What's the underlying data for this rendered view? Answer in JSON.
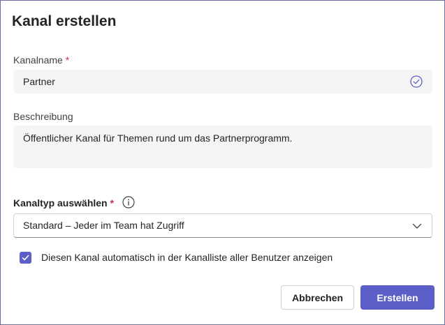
{
  "dialog": {
    "title": "Kanal erstellen"
  },
  "channel_name": {
    "label": "Kanalname",
    "required_marker": "*",
    "value": "Partner",
    "status_icon": "check-circle-icon"
  },
  "description": {
    "label": "Beschreibung",
    "value": "Öffentlicher Kanal für Themen rund um das Partnerprogramm."
  },
  "channel_type": {
    "label": "Kanaltyp auswählen",
    "required_marker": "*",
    "info_icon": "info-icon",
    "selected": "Standard – Jeder im Team hat Zugriff",
    "dropdown_icon": "chevron-down-icon"
  },
  "auto_show": {
    "checked": true,
    "label": "Diesen Kanal automatisch in der Kanalliste aller Benutzer anzeigen"
  },
  "actions": {
    "cancel_label": "Abbrechen",
    "create_label": "Erstellen"
  },
  "colors": {
    "accent": "#5b5fc7",
    "required": "#c4314b",
    "field_bg": "#f5f5f5"
  }
}
